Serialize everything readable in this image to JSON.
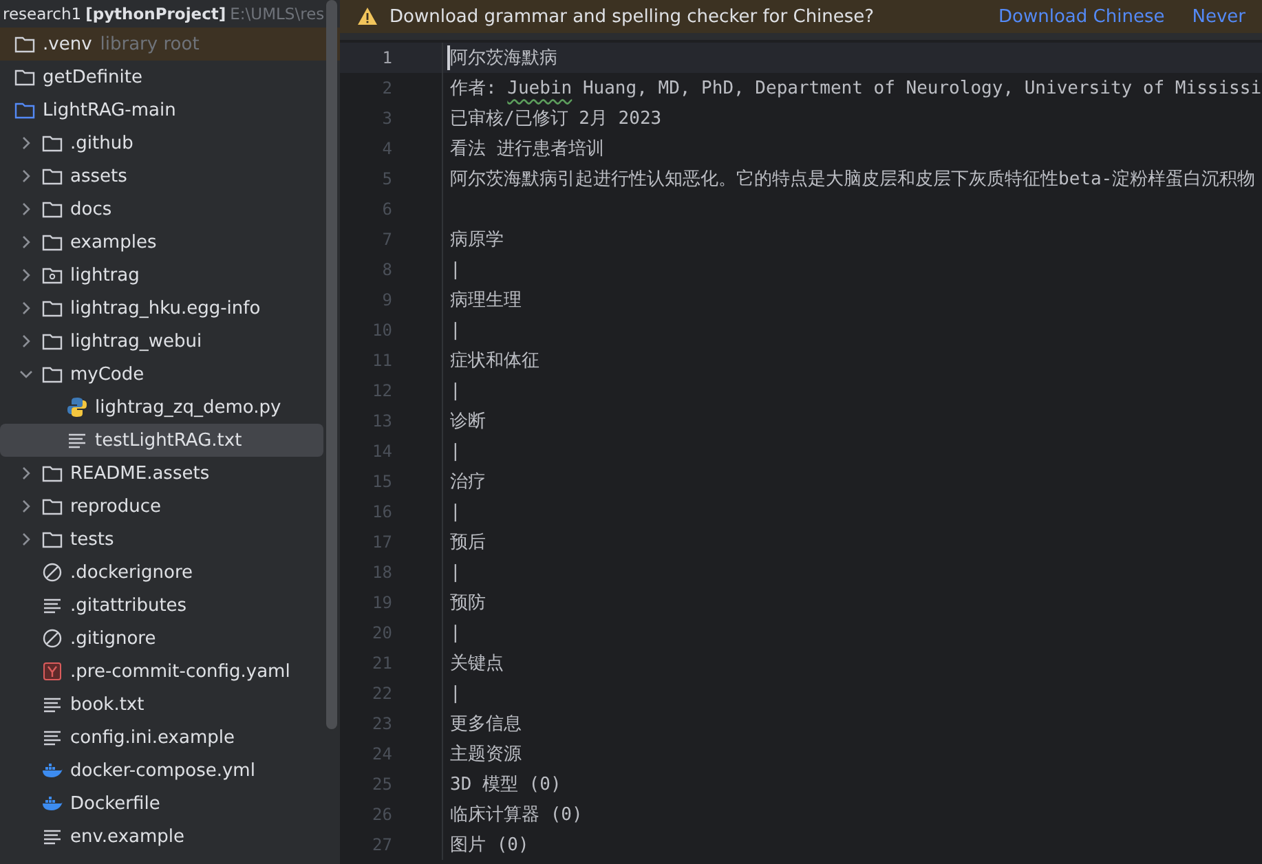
{
  "project_header": {
    "name": "research1",
    "project": "[pythonProject]",
    "path": "E:\\UMLS\\res"
  },
  "tree": [
    {
      "name": ".venv",
      "kind": "folder",
      "note": "library root",
      "highlighted": true,
      "selected": false
    },
    {
      "name": "getDefinite",
      "kind": "folder",
      "selected": false
    },
    {
      "name": "LightRAG-main",
      "kind": "project-folder",
      "selected": false,
      "children": [
        {
          "name": ".github",
          "kind": "folder",
          "expanded": false,
          "selected": false
        },
        {
          "name": "assets",
          "kind": "folder",
          "expanded": false,
          "selected": false
        },
        {
          "name": "docs",
          "kind": "folder",
          "expanded": false,
          "selected": false
        },
        {
          "name": "examples",
          "kind": "folder",
          "expanded": false,
          "selected": false
        },
        {
          "name": "lightrag",
          "kind": "package-folder",
          "expanded": false,
          "selected": false
        },
        {
          "name": "lightrag_hku.egg-info",
          "kind": "folder",
          "expanded": false,
          "selected": false
        },
        {
          "name": "lightrag_webui",
          "kind": "folder",
          "expanded": false,
          "selected": false
        },
        {
          "name": "myCode",
          "kind": "folder",
          "expanded": true,
          "selected": false,
          "children": [
            {
              "name": "lightrag_zq_demo.py",
              "kind": "python",
              "selected": false
            },
            {
              "name": "testLightRAG.txt",
              "kind": "text",
              "selected": true
            }
          ]
        },
        {
          "name": "README.assets",
          "kind": "folder",
          "expanded": false,
          "selected": false
        },
        {
          "name": "reproduce",
          "kind": "folder",
          "expanded": false,
          "selected": false
        },
        {
          "name": "tests",
          "kind": "folder",
          "expanded": false,
          "selected": false
        },
        {
          "name": ".dockerignore",
          "kind": "ignore",
          "selected": false
        },
        {
          "name": ".gitattributes",
          "kind": "text",
          "selected": false
        },
        {
          "name": ".gitignore",
          "kind": "ignore",
          "selected": false
        },
        {
          "name": ".pre-commit-config.yaml",
          "kind": "yaml",
          "selected": false
        },
        {
          "name": "book.txt",
          "kind": "text",
          "selected": false
        },
        {
          "name": "config.ini.example",
          "kind": "text",
          "selected": false
        },
        {
          "name": "docker-compose.yml",
          "kind": "docker",
          "selected": false
        },
        {
          "name": "Dockerfile",
          "kind": "docker",
          "selected": false
        },
        {
          "name": "env.example",
          "kind": "text",
          "selected": false
        }
      ]
    }
  ],
  "banner": {
    "message": "Download grammar and spelling checker for Chinese?",
    "actions": [
      "Download Chinese",
      "Never"
    ]
  },
  "editor": {
    "lines": [
      {
        "number": "1",
        "current": true,
        "segments": [
          {
            "text": "阿尔茨海默病"
          }
        ]
      },
      {
        "number": "2",
        "current": false,
        "segments": [
          {
            "text": "作者: "
          },
          {
            "text": "Juebin",
            "typo": true
          },
          {
            "text": " Huang, MD, PhD, Department of Neurology, University of Mississi"
          }
        ]
      },
      {
        "number": "3",
        "current": false,
        "segments": [
          {
            "text": "已审核/已修订 2月 2023"
          }
        ]
      },
      {
        "number": "4",
        "current": false,
        "segments": [
          {
            "text": "看法 进行患者培训"
          }
        ]
      },
      {
        "number": "5",
        "current": false,
        "segments": [
          {
            "text": "阿尔茨海默病引起进行性认知恶化。它的特点是大脑皮层和皮层下灰质特征性beta-淀粉样蛋白沉积物"
          }
        ]
      },
      {
        "number": "6",
        "current": false
      },
      {
        "number": "7",
        "current": false,
        "segments": [
          {
            "text": "病原学"
          }
        ]
      },
      {
        "number": "8",
        "current": false,
        "segments": [
          {
            "text": "|"
          }
        ]
      },
      {
        "number": "9",
        "current": false,
        "segments": [
          {
            "text": "病理生理"
          }
        ]
      },
      {
        "number": "10",
        "current": false,
        "segments": [
          {
            "text": "|"
          }
        ]
      },
      {
        "number": "11",
        "current": false,
        "segments": [
          {
            "text": "症状和体征"
          }
        ]
      },
      {
        "number": "12",
        "current": false,
        "segments": [
          {
            "text": "|"
          }
        ]
      },
      {
        "number": "13",
        "current": false,
        "segments": [
          {
            "text": "诊断"
          }
        ]
      },
      {
        "number": "14",
        "current": false,
        "segments": [
          {
            "text": "|"
          }
        ]
      },
      {
        "number": "15",
        "current": false,
        "segments": [
          {
            "text": "治疗"
          }
        ]
      },
      {
        "number": "16",
        "current": false,
        "segments": [
          {
            "text": "|"
          }
        ]
      },
      {
        "number": "17",
        "current": false,
        "segments": [
          {
            "text": "预后"
          }
        ]
      },
      {
        "number": "18",
        "current": false,
        "segments": [
          {
            "text": "|"
          }
        ]
      },
      {
        "number": "19",
        "current": false,
        "segments": [
          {
            "text": "预防"
          }
        ]
      },
      {
        "number": "20",
        "current": false,
        "segments": [
          {
            "text": "|"
          }
        ]
      },
      {
        "number": "21",
        "current": false,
        "segments": [
          {
            "text": "关键点"
          }
        ]
      },
      {
        "number": "22",
        "current": false,
        "segments": [
          {
            "text": "|"
          }
        ]
      },
      {
        "number": "23",
        "current": false,
        "segments": [
          {
            "text": "更多信息"
          }
        ]
      },
      {
        "number": "24",
        "current": false,
        "segments": [
          {
            "text": "主题资源"
          }
        ]
      },
      {
        "number": "25",
        "current": false,
        "segments": [
          {
            "text": "3D 模型 (0)"
          }
        ]
      },
      {
        "number": "26",
        "current": false,
        "segments": [
          {
            "text": "临床计算器 (0)"
          }
        ]
      },
      {
        "number": "27",
        "current": false,
        "segments": [
          {
            "text": "图片 (0)"
          }
        ]
      }
    ]
  }
}
